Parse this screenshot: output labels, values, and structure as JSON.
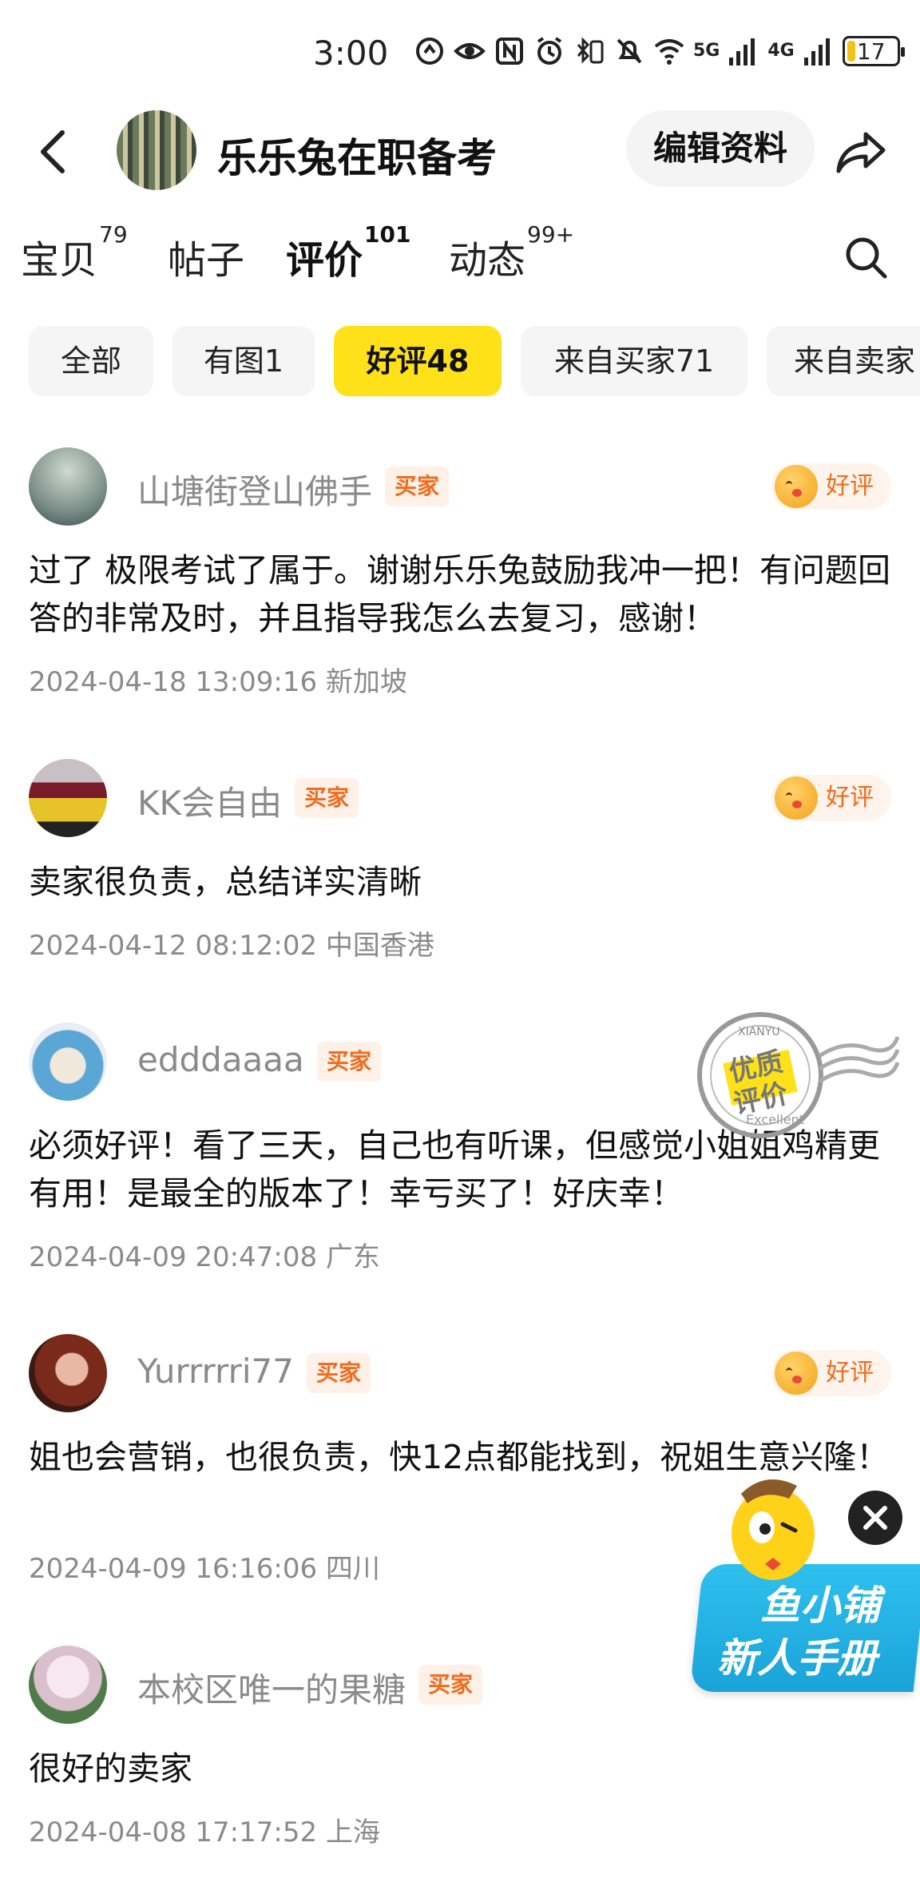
{
  "status_bar": {
    "time": "3:00",
    "signal_5g": "5G",
    "signal_4g": "4G",
    "battery": "17",
    "battery_level": 0.17
  },
  "header": {
    "shop_name": "乐乐兔在职备考",
    "edit_button": "编辑资料"
  },
  "tabs": [
    {
      "label": "宝贝",
      "count": "79"
    },
    {
      "label": "帖子",
      "count": ""
    },
    {
      "label": "评价",
      "count": "101"
    },
    {
      "label": "动态",
      "count": "99+"
    }
  ],
  "chips": [
    "全部",
    "有图1",
    "好评48",
    "来自买家71",
    "来自卖家"
  ],
  "reviews": [
    {
      "name": "山塘街登山佛手",
      "badge": "买家",
      "rating": "好评",
      "text": "过了 极限考试了属于。谢谢乐乐兔鼓励我冲一把！有问题回答的非常及时，并且指导我怎么去复习，感谢！",
      "date": "2024-04-18 13:09:16 新加坡"
    },
    {
      "name": "KK会自由",
      "badge": "买家",
      "rating": "好评",
      "text": "卖家很负责，总结详实清晰",
      "date": "2024-04-12 08:12:02 中国香港"
    },
    {
      "name": "edddaaaa",
      "badge": "买家",
      "rating": "",
      "text": "必须好评！看了三天，自己也有听课，但感觉小姐姐鸡精更有用！是最全的版本了！幸亏买了！好庆幸！",
      "date": "2024-04-09 20:47:08 广东"
    },
    {
      "name": "Yurrrrri77",
      "badge": "买家",
      "rating": "好评",
      "text": "姐也会营销，也很负责，快12点都能找到，祝姐生意兴隆！",
      "date": "2024-04-09 16:16:06 四川"
    },
    {
      "name": "本校区唯一的果糖",
      "badge": "买家",
      "rating": "",
      "text": "很好的卖家",
      "date": "2024-04-08 17:17:52 上海"
    }
  ],
  "stamp": {
    "line1": "优质",
    "line2": "评价",
    "top": "XIANYU",
    "bottom": "Excellent"
  },
  "promo": {
    "line1": "鱼小铺",
    "line2": "新人手册"
  }
}
